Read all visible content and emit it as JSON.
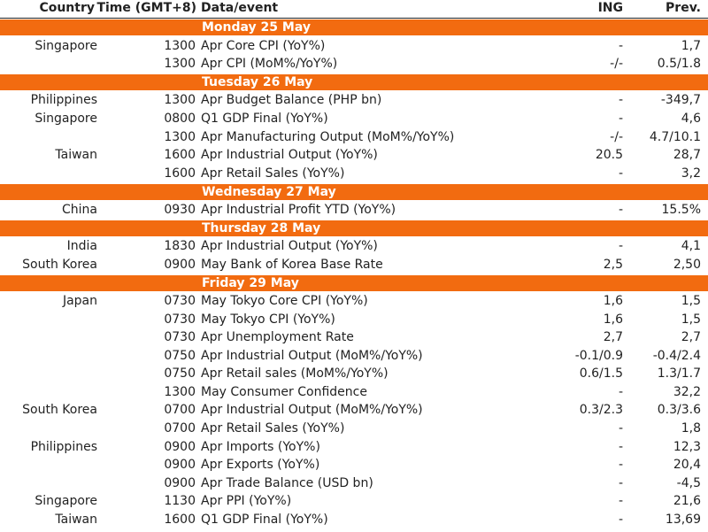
{
  "headers": {
    "country": "Country",
    "time": "Time (GMT+8)",
    "event": "Data/event",
    "ing": "ING",
    "prev": "Prev."
  },
  "sections": [
    {
      "day": "Monday 25 May",
      "rows": [
        {
          "country": "Singapore",
          "time": "1300",
          "event": "Apr Core CPI (YoY%)",
          "ing": "-",
          "prev": "1,7"
        },
        {
          "country": "",
          "time": "1300",
          "event": "Apr CPI (MoM%/YoY%)",
          "ing": "-/-",
          "prev": "0.5/1.8"
        }
      ]
    },
    {
      "day": "Tuesday 26 May",
      "rows": [
        {
          "country": "Philippines",
          "time": "1300",
          "event": "Apr Budget Balance (PHP bn)",
          "ing": "-",
          "prev": "-349,7"
        },
        {
          "country": "Singapore",
          "time": "0800",
          "event": "Q1 GDP Final (YoY%)",
          "ing": "-",
          "prev": "4,6"
        },
        {
          "country": "",
          "time": "1300",
          "event": "Apr Manufacturing Output (MoM%/YoY%)",
          "ing": "-/-",
          "prev": "4.7/10.1"
        },
        {
          "country": "Taiwan",
          "time": "1600",
          "event": "Apr Industrial Output (YoY%)",
          "ing": "20.5",
          "prev": "28,7"
        },
        {
          "country": "",
          "time": "1600",
          "event": "Apr Retail Sales (YoY%)",
          "ing": "-",
          "prev": "3,2"
        }
      ]
    },
    {
      "day": "Wednesday 27 May",
      "rows": [
        {
          "country": "China",
          "time": "0930",
          "event": "Apr Industrial Profit YTD (YoY%)",
          "ing": "-",
          "prev": "15.5%"
        }
      ]
    },
    {
      "day": "Thursday 28 May",
      "rows": [
        {
          "country": "India",
          "time": "1830",
          "event": "Apr Industrial Output (YoY%)",
          "ing": "-",
          "prev": "4,1"
        },
        {
          "country": "South Korea",
          "time": "0900",
          "event": "May Bank of Korea Base Rate",
          "ing": "2,5",
          "prev": "2,50"
        }
      ]
    },
    {
      "day": "Friday 29 May",
      "rows": [
        {
          "country": "Japan",
          "time": "0730",
          "event": "May Tokyo Core CPI (YoY%)",
          "ing": "1,6",
          "prev": "1,5"
        },
        {
          "country": "",
          "time": "0730",
          "event": "May Tokyo CPI (YoY%)",
          "ing": "1,6",
          "prev": "1,5"
        },
        {
          "country": "",
          "time": "0730",
          "event": "Apr Unemployment Rate",
          "ing": "2,7",
          "prev": "2,7"
        },
        {
          "country": "",
          "time": "0750",
          "event": "Apr Industrial Output (MoM%/YoY%)",
          "ing": "-0.1/0.9",
          "prev": "-0.4/2.4"
        },
        {
          "country": "",
          "time": "0750",
          "event": "Apr Retail sales (MoM%/YoY%)",
          "ing": "0.6/1.5",
          "prev": "1.3/1.7"
        },
        {
          "country": "",
          "time": "1300",
          "event": "May Consumer Confidence",
          "ing": "-",
          "prev": "32,2"
        },
        {
          "country": "South Korea",
          "time": "0700",
          "event": "Apr Industrial Output (MoM%/YoY%)",
          "ing": "0.3/2.3",
          "prev": "0.3/3.6"
        },
        {
          "country": "",
          "time": "0700",
          "event": "Apr Retail Sales (YoY%)",
          "ing": "-",
          "prev": "1,8"
        },
        {
          "country": "Philippines",
          "time": "0900",
          "event": "Apr Imports (YoY%)",
          "ing": "-",
          "prev": "12,3"
        },
        {
          "country": "",
          "time": "0900",
          "event": "Apr Exports (YoY%)",
          "ing": "-",
          "prev": "20,4"
        },
        {
          "country": "",
          "time": "0900",
          "event": "Apr Trade Balance (USD bn)",
          "ing": "-",
          "prev": "-4,5"
        },
        {
          "country": "Singapore",
          "time": "1130",
          "event": "Apr PPI (YoY%)",
          "ing": "-",
          "prev": "21,6"
        },
        {
          "country": "Taiwan",
          "time": "1600",
          "event": "Q1 GDP Final (YoY%)",
          "ing": "-",
          "prev": "13,69"
        }
      ]
    }
  ],
  "colors": {
    "day_banner": "#f26b10"
  }
}
